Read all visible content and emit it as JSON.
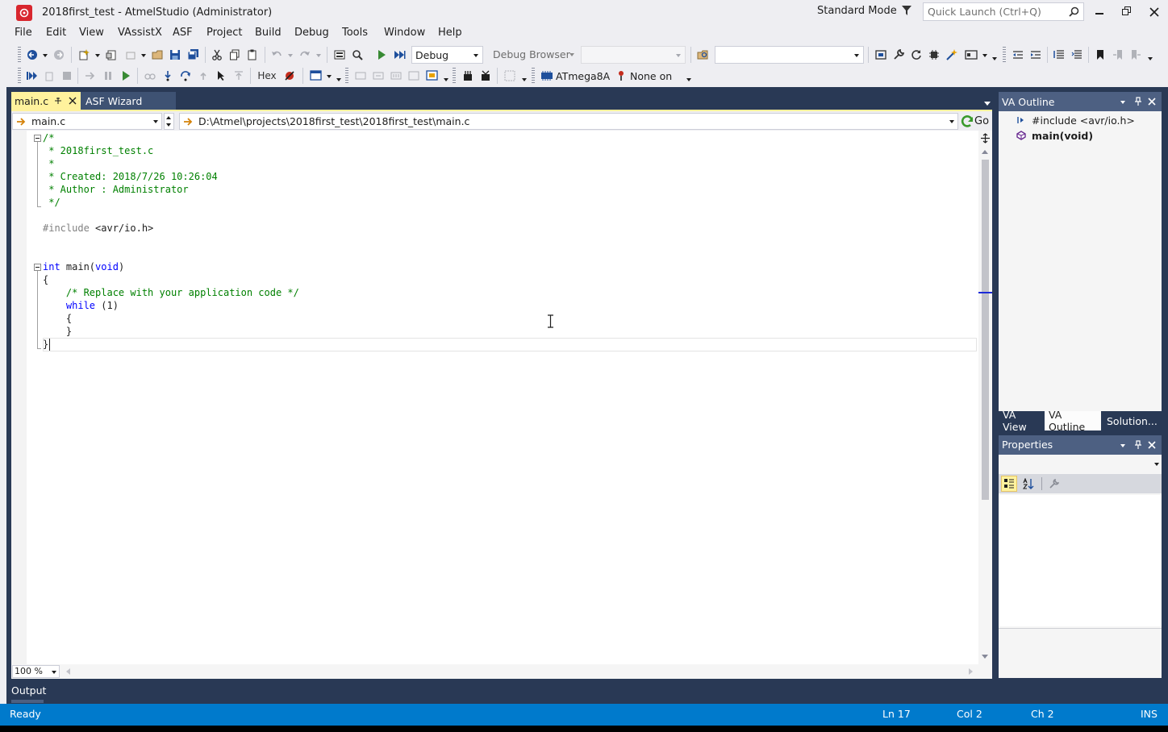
{
  "window": {
    "title": "2018first_test - AtmelStudio (Administrator)",
    "mode": "Standard Mode",
    "quick_launch_placeholder": "Quick Launch (Ctrl+Q)"
  },
  "menu": [
    "File",
    "Edit",
    "View",
    "VAssistX",
    "ASF",
    "Project",
    "Build",
    "Debug",
    "Tools",
    "Window",
    "Help"
  ],
  "toolbar": {
    "config": "Debug",
    "debug_browser": "Debug Browser",
    "hex_label": "Hex",
    "device": "ATmega8A",
    "tool": "None on"
  },
  "tabs": [
    {
      "label": "main.c",
      "active": true
    },
    {
      "label": "ASF Wizard",
      "active": false
    }
  ],
  "editor": {
    "file_combo": "main.c",
    "path_combo": "D:\\Atmel\\projects\\2018first_test\\2018first_test\\main.c",
    "go_label": "Go",
    "zoom": "100 %",
    "lines": [
      [
        {
          "t": "/*",
          "c": "com"
        }
      ],
      [
        {
          "t": " * 2018first_test.c",
          "c": "com"
        }
      ],
      [
        {
          "t": " *",
          "c": "com"
        }
      ],
      [
        {
          "t": " * Created: 2018/7/26 10:26:04",
          "c": "com"
        }
      ],
      [
        {
          "t": " * Author : Administrator",
          "c": "com"
        }
      ],
      [
        {
          "t": " */",
          "c": "com"
        }
      ],
      [],
      [
        {
          "t": "#include",
          "c": "pp"
        },
        {
          "t": " <avr/io.h>",
          "c": "txt"
        }
      ],
      [],
      [],
      [
        {
          "t": "int",
          "c": "kw"
        },
        {
          "t": " main(",
          "c": "txt"
        },
        {
          "t": "void",
          "c": "kw"
        },
        {
          "t": ")",
          "c": "txt"
        }
      ],
      [
        {
          "t": "{",
          "c": "txt"
        }
      ],
      [
        {
          "t": "    /* Replace with your application code */",
          "c": "com"
        }
      ],
      [
        {
          "t": "    ",
          "c": "txt"
        },
        {
          "t": "while",
          "c": "kw"
        },
        {
          "t": " (1)",
          "c": "txt"
        }
      ],
      [
        {
          "t": "    {",
          "c": "txt"
        }
      ],
      [
        {
          "t": "    }",
          "c": "txt"
        }
      ],
      [
        {
          "t": "}",
          "c": "txt"
        }
      ]
    ]
  },
  "va_outline": {
    "title": "VA Outline",
    "items": [
      {
        "label": "#include <avr/io.h>",
        "kind": "include"
      },
      {
        "label": "main(void)",
        "kind": "function"
      }
    ],
    "bottom_tabs": [
      "VA View",
      "VA Outline",
      "Solution..."
    ]
  },
  "properties": {
    "title": "Properties"
  },
  "output": {
    "label": "Output"
  },
  "status": {
    "ready": "Ready",
    "ln": "Ln 17",
    "col": "Col 2",
    "ch": "Ch 2",
    "ins": "INS"
  },
  "colors": {
    "chrome": "#eeeef2",
    "frame": "#293955",
    "active_tab": "#fff29d",
    "statusbar": "#007acc",
    "selected_tab": "#fcfcfc"
  }
}
